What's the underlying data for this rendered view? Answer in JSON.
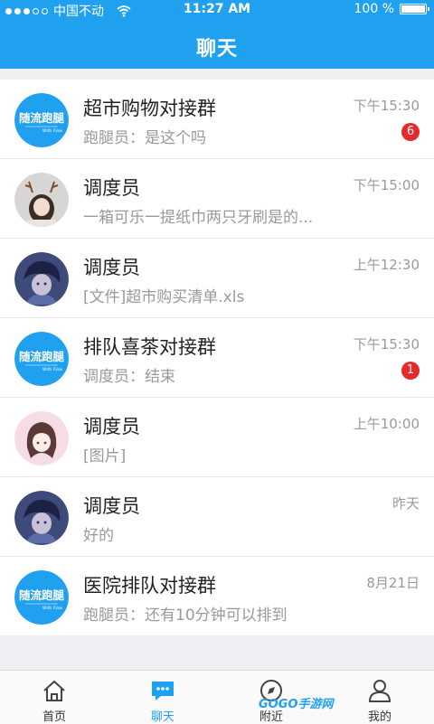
{
  "status_bar": {
    "carrier": "中国不动",
    "time": "11:27 AM",
    "battery": "100 %"
  },
  "header": {
    "title": "聊天"
  },
  "chats": [
    {
      "name": "超市购物对接群",
      "preview": "跑腿员：是这个吗",
      "time": "下午15:30",
      "badge": "6",
      "avatar": "logo"
    },
    {
      "name": "调度员",
      "preview": "一箱可乐一提纸巾两只牙刷是的...",
      "time": "下午15:00",
      "badge": "",
      "avatar": "girl-antlers"
    },
    {
      "name": "调度员",
      "preview": "[文件]超市购买清单.xls",
      "time": "上午12:30",
      "badge": "",
      "avatar": "anime-boy"
    },
    {
      "name": "排队喜茶对接群",
      "preview": "调度员：结束",
      "time": "下午15:30",
      "badge": "1",
      "avatar": "logo"
    },
    {
      "name": "调度员",
      "preview": "[图片]",
      "time": "上午10:00",
      "badge": "",
      "avatar": "anime-girl"
    },
    {
      "name": "调度员",
      "preview": "好的",
      "time": "昨天",
      "badge": "",
      "avatar": "anime-boy"
    },
    {
      "name": "医院排队对接群",
      "preview": "跑腿员：还有10分钟可以排到",
      "time": "8月21日",
      "badge": "",
      "avatar": "logo"
    }
  ],
  "logo_text": {
    "main": "随流跑腿",
    "sub": "With Flow"
  },
  "tabs": [
    {
      "label": "首页",
      "icon": "home-icon"
    },
    {
      "label": "聊天",
      "icon": "chat-icon"
    },
    {
      "label": "附近",
      "icon": "compass-icon"
    },
    {
      "label": "我的",
      "icon": "user-icon"
    }
  ],
  "watermark": "GOGO手游网",
  "colors": {
    "accent": "#1fa1f0",
    "badge": "#e52a2a"
  }
}
